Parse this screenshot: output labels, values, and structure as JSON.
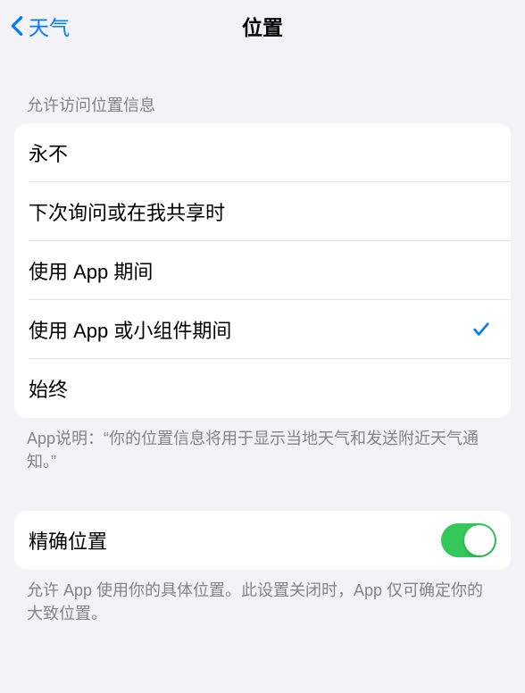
{
  "nav": {
    "back_label": "天气",
    "title": "位置"
  },
  "section1": {
    "header": "允许访问位置信息",
    "options": [
      {
        "label": "永不",
        "selected": false
      },
      {
        "label": "下次询问或在我共享时",
        "selected": false
      },
      {
        "label": "使用 App 期间",
        "selected": false
      },
      {
        "label": "使用 App 或小组件期间",
        "selected": true
      },
      {
        "label": "始终",
        "selected": false
      }
    ],
    "footer": "App说明：“你的位置信息将用于显示当地天气和发送附近天气通知。”"
  },
  "section2": {
    "precise_label": "精确位置",
    "precise_on": true,
    "footer": "允许 App 使用你的具体位置。此设置关闭时，App 仅可确定你的大致位置。"
  },
  "colors": {
    "accent": "#007aff",
    "switch_on": "#34c759"
  }
}
